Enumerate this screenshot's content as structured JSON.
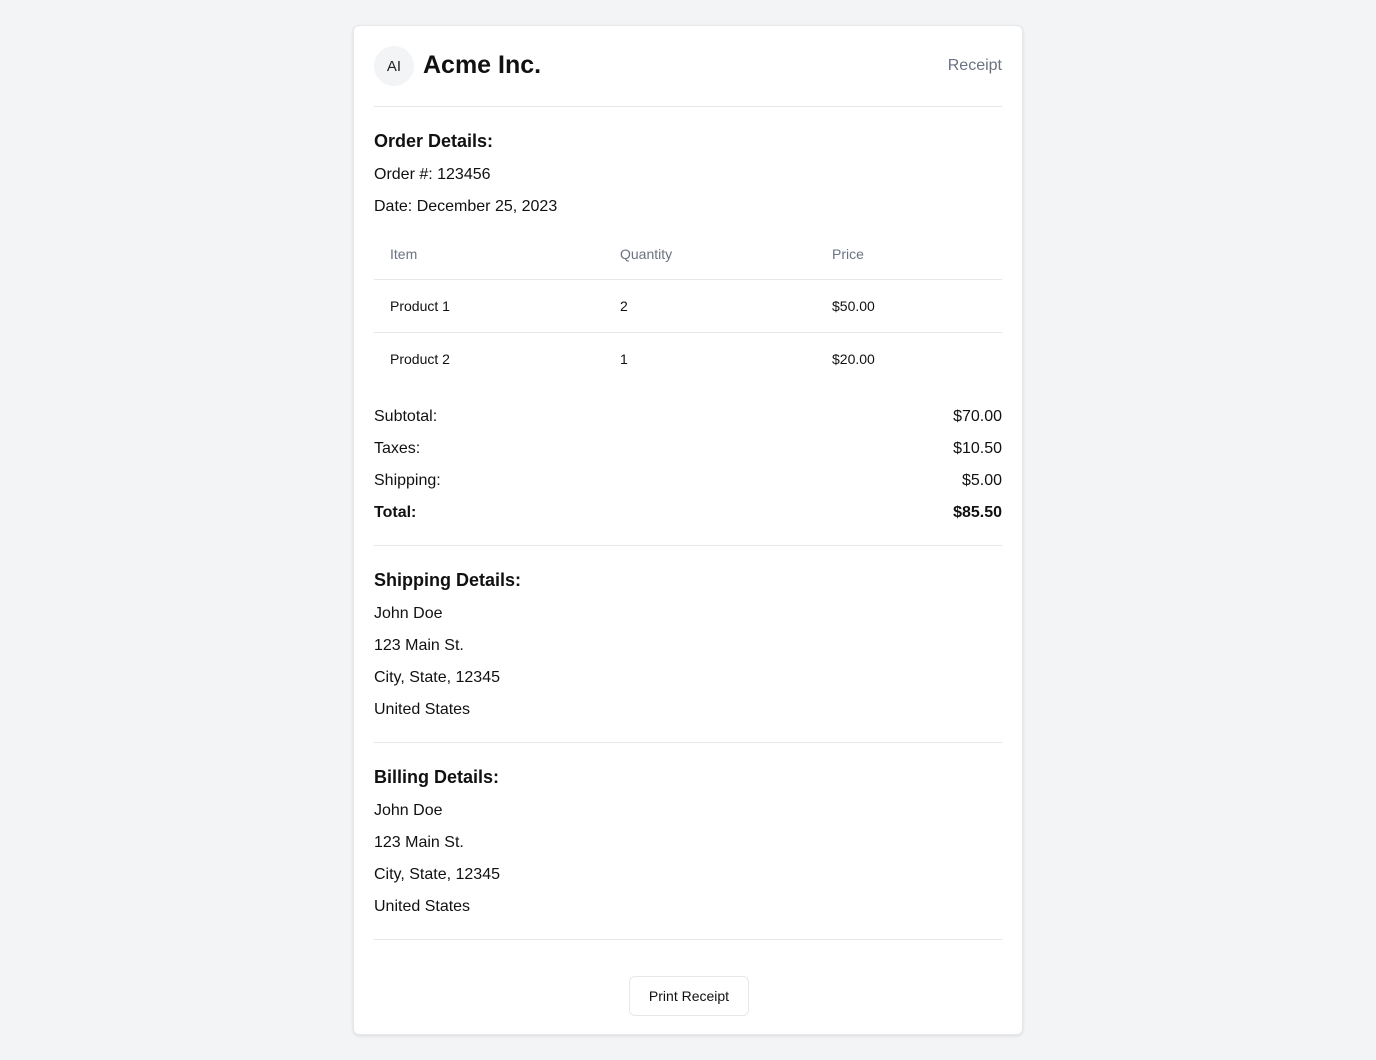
{
  "header": {
    "avatar_initials": "AI",
    "brand": "Acme Inc.",
    "label": "Receipt"
  },
  "order": {
    "title": "Order Details:",
    "order_number": "Order #: 123456",
    "date": "Date: December 25, 2023",
    "columns": [
      "Item",
      "Quantity",
      "Price"
    ],
    "rows": [
      [
        "Product 1",
        "2",
        "$50.00"
      ],
      [
        "Product 2",
        "1",
        "$20.00"
      ]
    ]
  },
  "summary": {
    "subtotal_label": "Subtotal:",
    "subtotal_value": "$70.00",
    "taxes_label": "Taxes:",
    "taxes_value": "$10.50",
    "shipping_label": "Shipping:",
    "shipping_value": "$5.00",
    "total_label": "Total:",
    "total_value": "$85.50"
  },
  "shipping": {
    "title": "Shipping Details:",
    "lines": [
      "John Doe",
      "123 Main St.",
      "City, State, 12345",
      "United States"
    ]
  },
  "billing": {
    "title": "Billing Details:",
    "lines": [
      "John Doe",
      "123 Main St.",
      "City, State, 12345",
      "United States"
    ]
  },
  "actions": {
    "print_label": "Print Receipt"
  }
}
